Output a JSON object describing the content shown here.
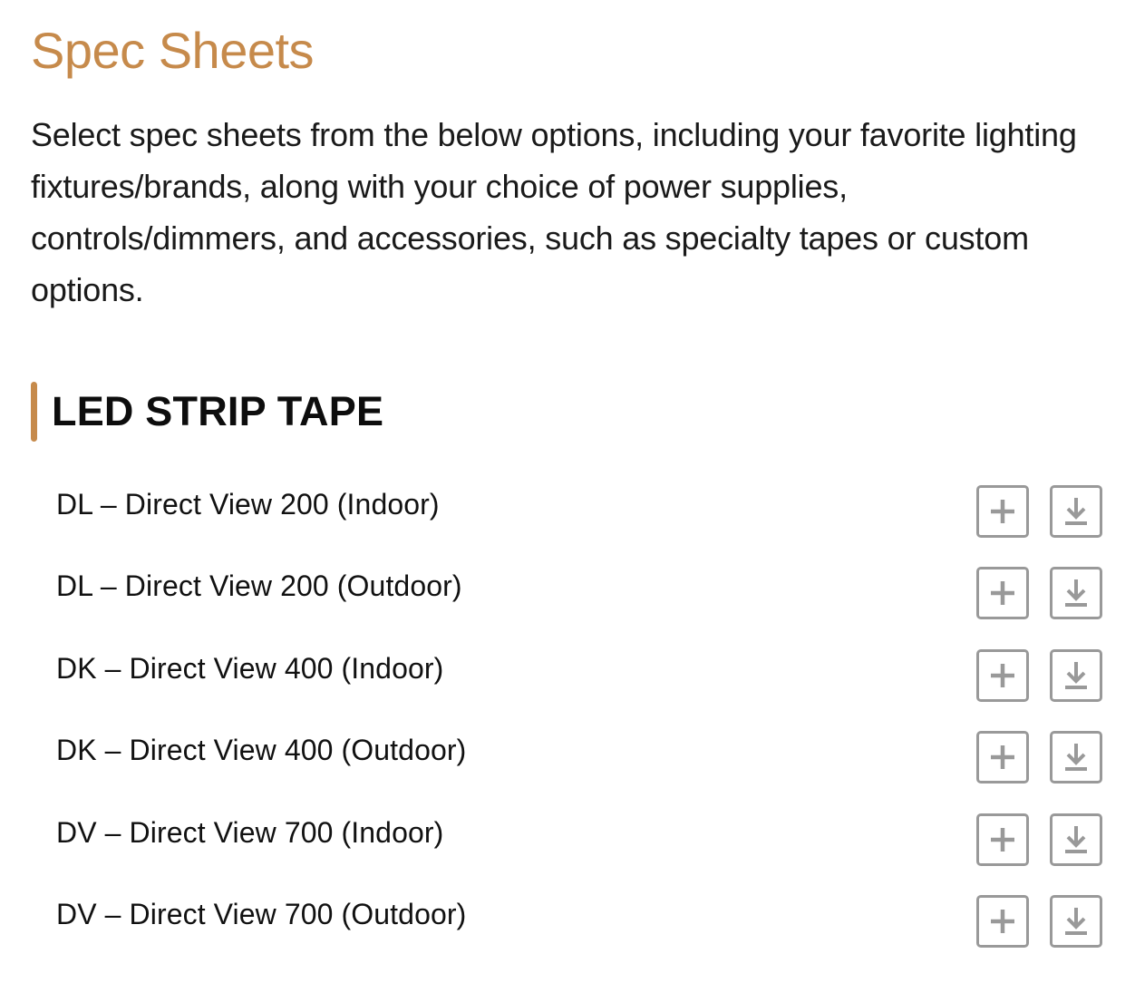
{
  "page": {
    "title": "Spec Sheets",
    "intro": "Select spec sheets from the below options, including your favorite lighting fixtures/brands, along with your choice of power supplies, controls/dimmers, and accessories, such as specialty tapes or custom options."
  },
  "section": {
    "title": "LED STRIP TAPE",
    "items": [
      {
        "label": "DL – Direct View 200 (Indoor)"
      },
      {
        "label": "DL – Direct View 200 (Outdoor)"
      },
      {
        "label": "DK – Direct View 400 (Indoor)"
      },
      {
        "label": "DK – Direct View 400 (Outdoor)"
      },
      {
        "label": "DV – Direct View 700 (Indoor)"
      },
      {
        "label": "DV – Direct View 700 (Outdoor)"
      }
    ]
  },
  "icons": {
    "add": "plus-icon",
    "download": "download-icon"
  },
  "colors": {
    "accent": "#c68a4b",
    "icon_border": "#999999",
    "text": "#111111"
  }
}
